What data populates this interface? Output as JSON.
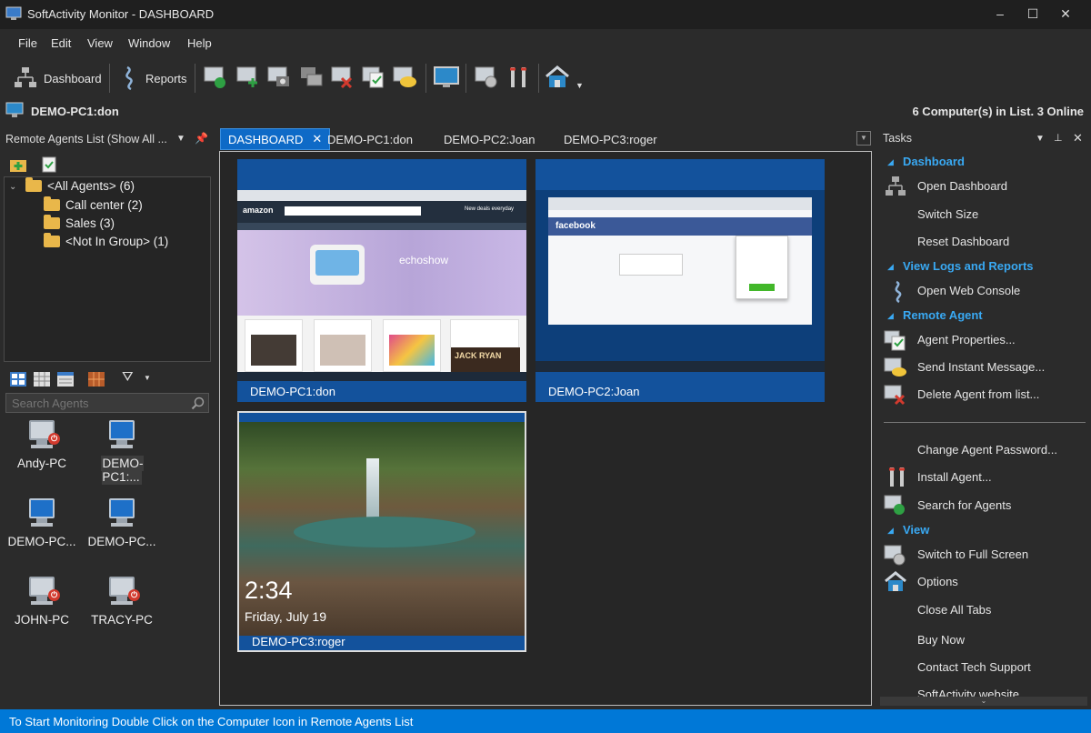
{
  "window": {
    "title": "SoftActivity Monitor - DASHBOARD",
    "minimize": "–",
    "maximize": "☐",
    "close": "✕"
  },
  "menu": [
    "File",
    "Edit",
    "View",
    "Window",
    "Help"
  ],
  "toolbar": {
    "dashboard_label": "Dashboard",
    "reports_label": "Reports"
  },
  "infobar": {
    "current_agent": "DEMO-PC1:don",
    "summary": "6 Computer(s) in List. 3 Online"
  },
  "left_panel": {
    "header": "Remote Agents List (Show All ...",
    "tree": {
      "all": "<All Agents> (6)",
      "groups": [
        "Call center (2)",
        "Sales (3)",
        "<Not In Group> (1)"
      ]
    },
    "search_placeholder": "Search Agents",
    "agents": [
      "Andy-PC",
      "DEMO-PC1:...",
      "DEMO-PC...",
      "DEMO-PC...",
      "JOHN-PC",
      "TRACY-PC"
    ]
  },
  "tabs": [
    "DASHBOARD",
    "DEMO-PC1:don",
    "DEMO-PC2:Joan",
    "DEMO-PC3:roger"
  ],
  "thumbnails": [
    {
      "label": "DEMO-PC1:don",
      "screen_text": [
        "amazon",
        "echoshow",
        "New deals everyday",
        "JACK RYAN"
      ]
    },
    {
      "label": "DEMO-PC2:Joan",
      "screen_text": [
        "facebook"
      ]
    },
    {
      "label": "DEMO-PC3:roger",
      "clock": "2:34",
      "date": "Friday, July 19"
    }
  ],
  "tasks": {
    "header": "Tasks",
    "sections": {
      "dashboard": "Dashboard",
      "logs": "View Logs and Reports",
      "remote": "Remote Agent",
      "view": "View"
    },
    "items": {
      "open_dashboard": "Open Dashboard",
      "switch_size": "Switch Size",
      "reset_dashboard": "Reset Dashboard",
      "open_web_console": "Open Web Console",
      "agent_properties": "Agent Properties...",
      "send_message": "Send Instant Message...",
      "delete_agent": "Delete Agent from list...",
      "change_password": "Change Agent Password...",
      "install_agent": "Install Agent...",
      "search_agents": "Search for Agents",
      "full_screen": "Switch to Full Screen",
      "options": "Options",
      "close_tabs": "Close All Tabs",
      "buy_now": "Buy Now",
      "contact_support": "Contact Tech Support",
      "website": "SoftActivity website"
    }
  },
  "statusbar": {
    "text": "To Start Monitoring Double Click on the Computer Icon in Remote Agents List"
  },
  "colors": {
    "accent": "#0078d7",
    "thumb_frame": "#13529c",
    "section": "#39a9f3",
    "bg": "#2b2b2b"
  }
}
